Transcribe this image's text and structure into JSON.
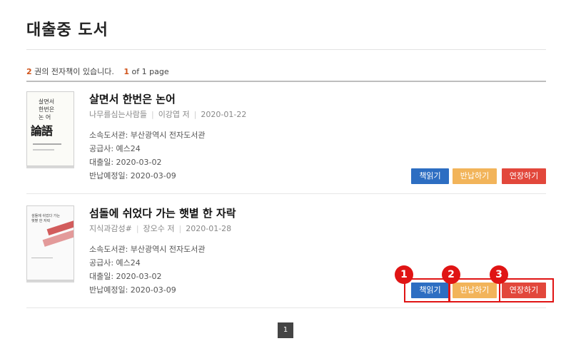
{
  "page_title": "대출중 도서",
  "summary": {
    "count": "2",
    "count_text": "권의 전자책이 있습니다.",
    "page_current": "1",
    "page_text": "of 1 page"
  },
  "books": [
    {
      "title": "살면서 한번은 논어",
      "publisher": "나무를심는사람들",
      "author": "이강엽 저",
      "pub_date": "2020-01-22",
      "library": "소속도서관: 부산광역시 전자도서관",
      "supplier": "공급사: 예스24",
      "loan_date": "대출일: 2020-03-02",
      "due_date": "반납예정일: 2020-03-09",
      "cover_text_1": "살면서",
      "cover_text_2": "한번은",
      "cover_text_3": "논 어",
      "cover_big": "論語"
    },
    {
      "title": "섬돌에 쉬었다 가는 햇볕 한 자락",
      "publisher": "지식과감성#",
      "author": "장오수 저",
      "pub_date": "2020-01-28",
      "library": "소속도서관: 부산광역시 전자도서관",
      "supplier": "공급사: 예스24",
      "loan_date": "대출일: 2020-03-02",
      "due_date": "반납예정일: 2020-03-09",
      "cover_text_1": "섬돌에 쉬었다 가는",
      "cover_text_2": "햇볕 한 자락"
    }
  ],
  "buttons": {
    "read": "책읽기",
    "return": "반납하기",
    "extend": "연장하기"
  },
  "badges": [
    "1",
    "2",
    "3"
  ],
  "pagination": {
    "current": "1"
  },
  "colors": {
    "read": "#2d6ec2",
    "return": "#f2b45a",
    "extend": "#e2473b",
    "highlight": "#e01414",
    "accent": "#d0541b"
  }
}
